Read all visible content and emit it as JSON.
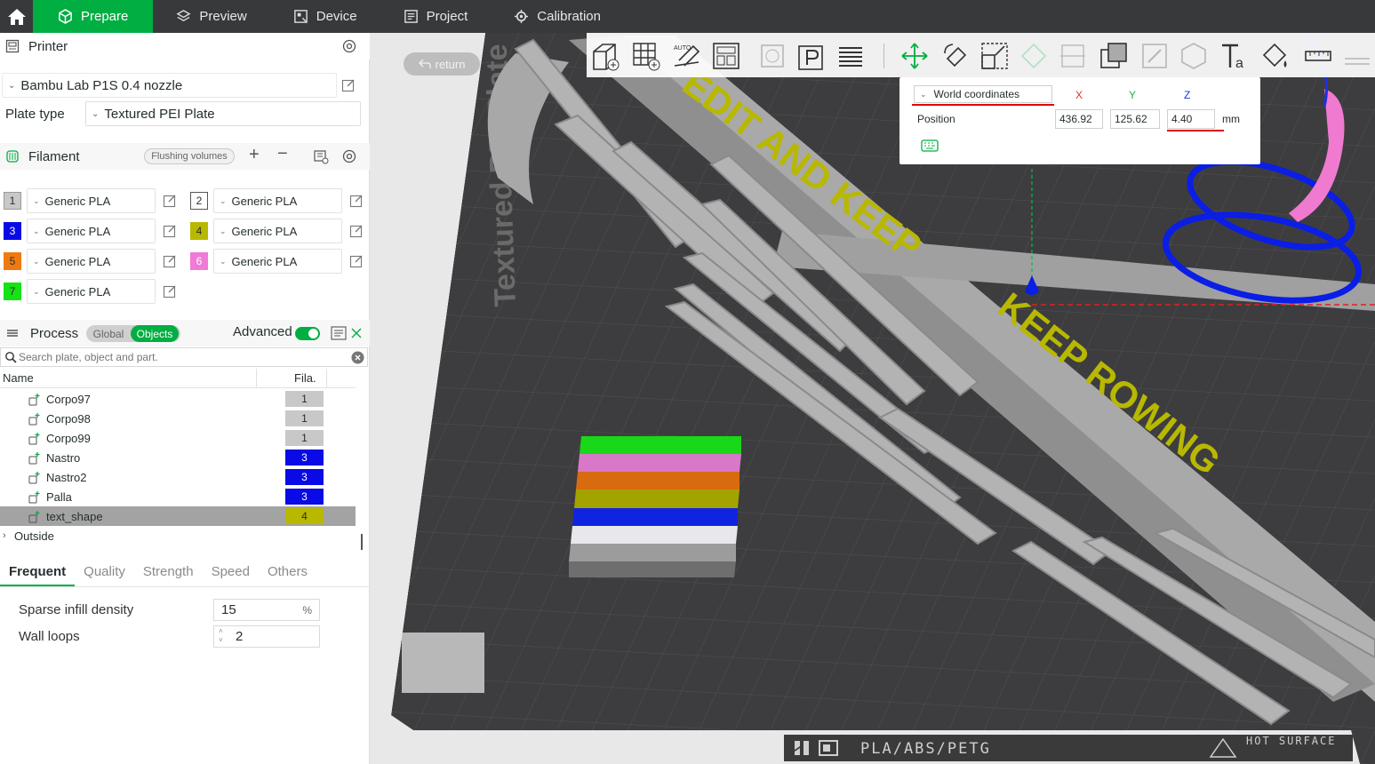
{
  "topbar": {
    "tabs": [
      {
        "label": "Prepare"
      },
      {
        "label": "Preview"
      },
      {
        "label": "Device"
      },
      {
        "label": "Project"
      },
      {
        "label": "Calibration"
      }
    ],
    "active_color": "#00ae42"
  },
  "printer": {
    "section_label": "Printer",
    "selected_printer": "Bambu Lab P1S 0.4 nozzle",
    "plate_type_label": "Plate type",
    "plate_type_value": "Textured PEI Plate"
  },
  "filament": {
    "section_label": "Filament",
    "flushing_button": "Flushing volumes",
    "slots": [
      {
        "num": "1",
        "name": "Generic PLA",
        "color": "#c8c8c8"
      },
      {
        "num": "2",
        "name": "Generic PLA",
        "color": "#ffffff"
      },
      {
        "num": "3",
        "name": "Generic PLA",
        "color": "#0a0ae6"
      },
      {
        "num": "4",
        "name": "Generic PLA",
        "color": "#b8b800"
      },
      {
        "num": "5",
        "name": "Generic PLA",
        "color": "#f07a10"
      },
      {
        "num": "6",
        "name": "Generic PLA",
        "color": "#f17ad8"
      },
      {
        "num": "7",
        "name": "Generic PLA",
        "color": "#16e216"
      }
    ]
  },
  "process": {
    "section_label": "Process",
    "global_label": "Global",
    "objects_label": "Objects",
    "advanced_label": "Advanced",
    "advanced_on": true,
    "search_placeholder": "Search plate, object and part."
  },
  "object_list": {
    "col_name": "Name",
    "col_fila": "Fila.",
    "rows": [
      {
        "name": "Corpo97",
        "fila": "1",
        "fila_color": "#c8c8c8",
        "selected": false
      },
      {
        "name": "Corpo98",
        "fila": "1",
        "fila_color": "#c8c8c8",
        "selected": false
      },
      {
        "name": "Corpo99",
        "fila": "1",
        "fila_color": "#c8c8c8",
        "selected": false
      },
      {
        "name": "Nastro",
        "fila": "3",
        "fila_color": "#0a0ae6",
        "selected": false
      },
      {
        "name": "Nastro2",
        "fila": "3",
        "fila_color": "#0a0ae6",
        "selected": false
      },
      {
        "name": "Palla",
        "fila": "3",
        "fila_color": "#0a0ae6",
        "selected": false
      },
      {
        "name": "text_shape",
        "fila": "4",
        "fila_color": "#b8b800",
        "selected": true
      }
    ],
    "outside_label": "Outside"
  },
  "settings_tabs": [
    "Frequent",
    "Quality",
    "Strength",
    "Speed",
    "Others"
  ],
  "settings": {
    "sparse_label": "Sparse infill density",
    "sparse_value": "15",
    "sparse_unit": "%",
    "wall_label": "Wall loops",
    "wall_value": "2"
  },
  "viewport": {
    "return_label": "return",
    "coord_mode": "World coordinates",
    "axis_x": "X",
    "axis_y": "Y",
    "axis_z": "Z",
    "position_label": "Position",
    "pos_x": "436.92",
    "pos_y": "125.62",
    "pos_z": "4.40",
    "unit": "mm",
    "plate_text": "Textured PEI Plate",
    "status_text": "PLA/ABS/PETG",
    "hot_surface": "HOT SURFACE",
    "model_text_1": "EDIT AND KEEP",
    "model_text_2": "KEEP ROWING"
  }
}
